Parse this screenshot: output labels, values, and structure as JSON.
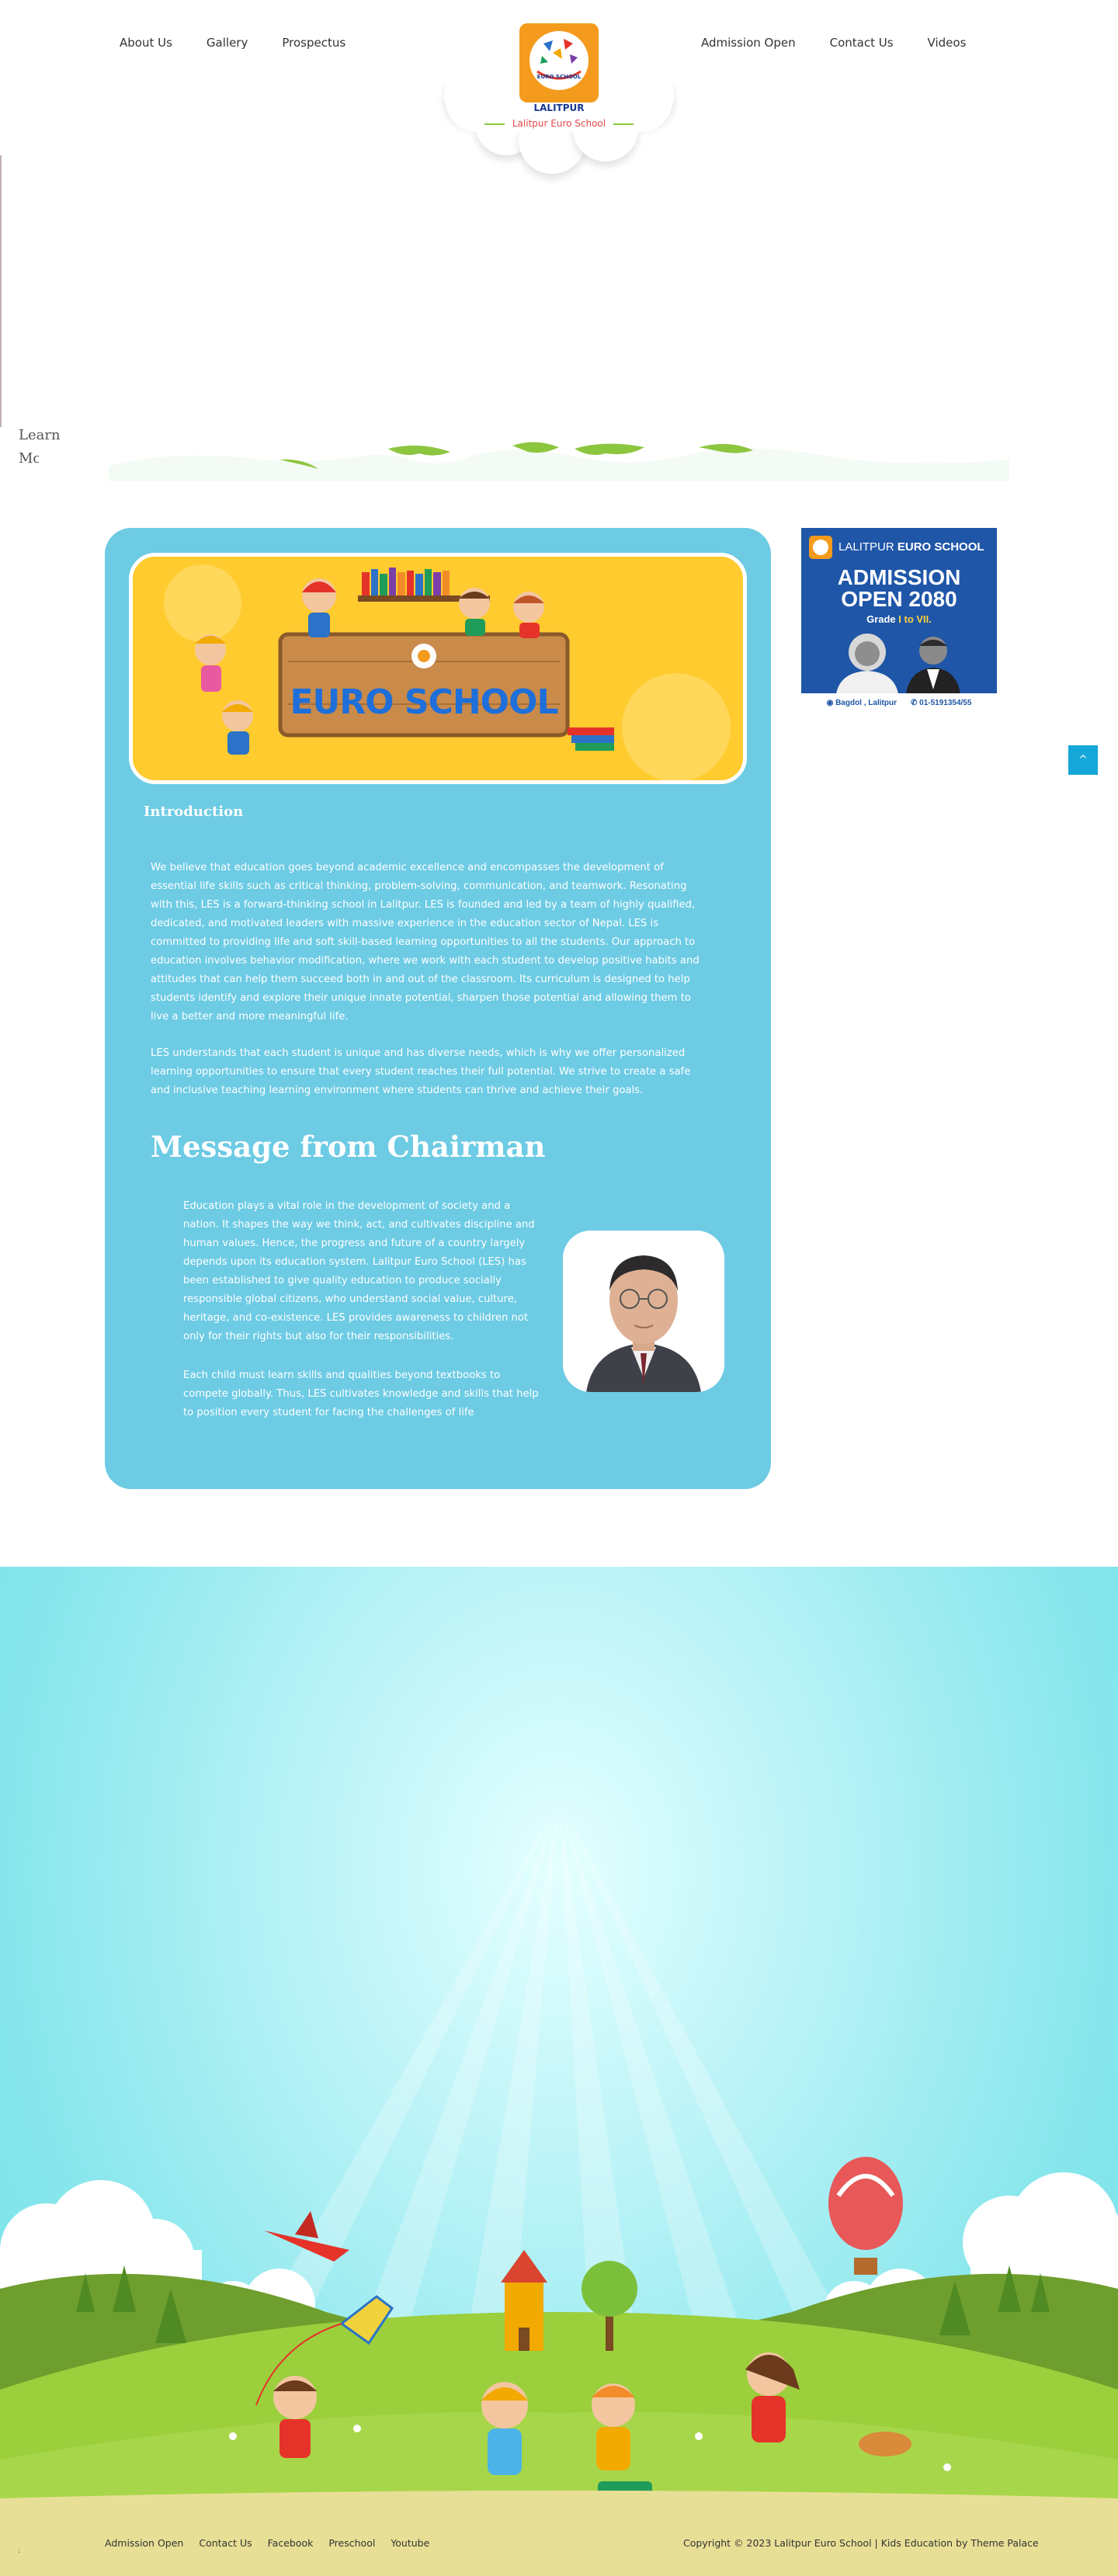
{
  "nav": {
    "left": [
      "About Us",
      "Gallery",
      "Prospectus"
    ],
    "right": [
      "Admission Open",
      "Contact Us",
      "Videos"
    ]
  },
  "logo": {
    "badge_text": "EURO SCHOOL",
    "name": "LALITPUR",
    "tagline": "Lalitpur Euro School"
  },
  "hero": {
    "line1": "Learn",
    "line2": "Mo"
  },
  "banner": {
    "title": "EURO SCHOOL"
  },
  "intro": {
    "heading": "Introduction",
    "paragraph1": "We believe that education goes beyond academic excellence and encompasses the development of essential life skills such as critical thinking, problem-solving, communication, and teamwork. Resonating with this, LES is a forward-thinking school in Lalitpur. LES is founded and led by a team of highly qualified, dedicated, and motivated leaders with massive experience in the education sector of Nepal. LES is committed to providing life and soft skill-based learning opportunities to all the students. Our approach to education involves behavior modification, where we work with each student to develop positive habits and attitudes that can help them succeed both in and out of the classroom. Its curriculum is designed to help students identify and explore their unique innate potential, sharpen those potential and allowing them to live a better and more meaningful life.",
    "paragraph2": "LES understands that each student is unique and has diverse needs, which is why we offer personalized learning opportunities to ensure that every student reaches their full potential. We strive to create a safe and inclusive teaching learning environment where students can thrive and achieve their goals."
  },
  "chairman": {
    "heading": "Message from Chairman",
    "paragraph1": "Education plays a vital role in the development of society and a nation. It shapes the way we think, act, and cultivates discipline and human values. Hence, the progress and future of a country largely depends upon its education system. Lalitpur Euro School (LES) has been established to give quality education to produce socially responsible global citizens, who understand social value, culture, heritage, and co-existence. LES provides awareness to children not only for their rights but also for their responsibilities.",
    "paragraph2": "Each child must learn skills and qualities beyond textbooks to compete globally. Thus, LES cultivates knowledge and skills that help to position every student for facing the challenges of life"
  },
  "ad": {
    "brand_light": "LALITPUR",
    "brand_bold": "EURO SCHOOL",
    "title_line1": "ADMISSION",
    "title_line2": "OPEN 2080",
    "grade_prefix": "Grade",
    "grade_value": "I to VII.",
    "location": "Bagdol , Lalitpur",
    "phone": "01-5191354/55"
  },
  "scroll_top": {
    "icon": "chevron-up-icon",
    "glyph": "^"
  },
  "footer": {
    "links": [
      "Admission Open",
      "Contact Us",
      "Facebook",
      "Preschool",
      "Youtube"
    ],
    "copyright": "Copyright © 2023 Lalitpur Euro School | Kids Education by",
    "theme_credit": "Theme Palace",
    "corner_mark": "↓"
  },
  "colors": {
    "main_card": "#6dcbe4",
    "logo_orange": "#f49b1d",
    "tagline_red": "#e24848",
    "ad_blue": "#1f56a8",
    "scroll_button": "#14a7d8",
    "grass_green": "#8cc63f",
    "footer_sand": "#e8df96"
  }
}
